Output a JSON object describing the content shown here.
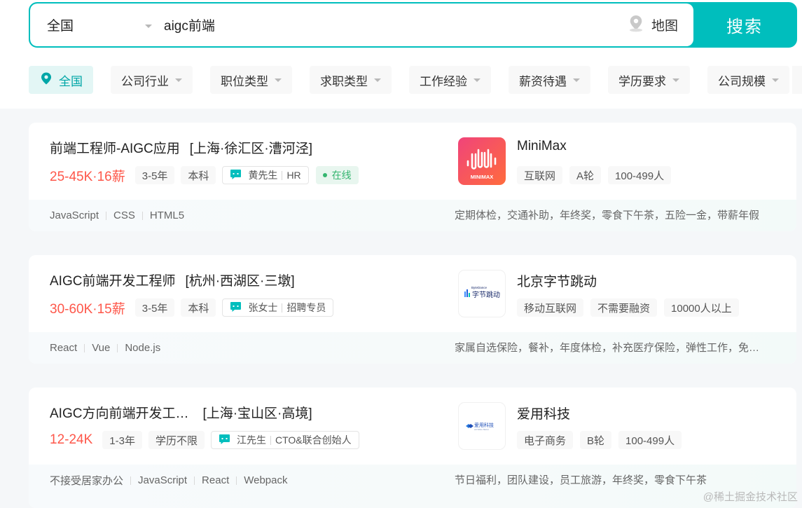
{
  "search": {
    "city": "全国",
    "query": "aigc前端",
    "map_label": "地图",
    "search_label": "搜索"
  },
  "filters": {
    "city": "全国",
    "items": [
      "公司行业",
      "职位类型",
      "求职类型",
      "工作经验",
      "薪资待遇",
      "学历要求",
      "公司规模"
    ]
  },
  "jobs": [
    {
      "title": "前端工程师-AIGC应用",
      "area": "[上海·徐汇区·漕河泾]",
      "salary": "25-45K·16薪",
      "tags": [
        "3-5年",
        "本科"
      ],
      "boss_name": "黄先生",
      "boss_role": "HR",
      "online": "在线",
      "company": "MiniMax",
      "company_tags": [
        "互联网",
        "A轮",
        "100-499人"
      ],
      "logo_text": "MINIMAX",
      "skills": [
        "JavaScript",
        "CSS",
        "HTML5"
      ],
      "welfare": "定期体检，交通补助，年终奖，零食下午茶，五险一金，带薪年假"
    },
    {
      "title": "AIGC前端开发工程师",
      "area": "[杭州·西湖区·三墩]",
      "salary": "30-60K·15薪",
      "tags": [
        "3-5年",
        "本科"
      ],
      "boss_name": "张女士",
      "boss_role": "招聘专员",
      "online": "",
      "company": "北京字节跳动",
      "company_tags": [
        "移动互联网",
        "不需要融资",
        "10000人以上"
      ],
      "logo_text": "字节跳动",
      "skills": [
        "React",
        "Vue",
        "Node.js"
      ],
      "welfare": "家属自选保险，餐补，年度体检，补充医疗保险，弹性工作，免费班车"
    },
    {
      "title": "AIGC方向前端开发工…",
      "area": "[上海·宝山区·高境]",
      "salary": "12-24K",
      "tags": [
        "1-3年",
        "学历不限"
      ],
      "boss_name": "江先生",
      "boss_role": "CTO&联合创始人",
      "online": "",
      "company": "爱用科技",
      "company_tags": [
        "电子商务",
        "B轮",
        "100-499人"
      ],
      "logo_text": "爱用科技",
      "skills": [
        "不接受居家办公",
        "JavaScript",
        "React",
        "Webpack"
      ],
      "welfare": "节日福利，团队建设，员工旅游，年终奖，零食下午茶"
    }
  ],
  "watermark": "@稀土掘金技术社区",
  "colors": {
    "accent": "#00bebd",
    "salary": "#fe574a",
    "online": "#34b56f"
  }
}
